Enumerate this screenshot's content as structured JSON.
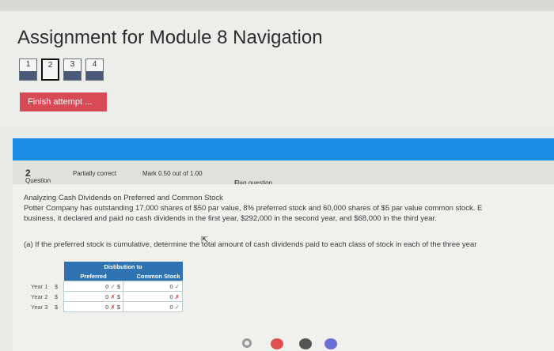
{
  "page": {
    "title": "Assignment for Module 8 Navigation"
  },
  "nav": {
    "buttons": [
      "1",
      "2",
      "3",
      "4"
    ],
    "current_index": 1
  },
  "finish_button": {
    "label": "Finish attempt ..."
  },
  "question": {
    "prefix": "Question",
    "number": "2",
    "status": "Partially correct",
    "mark": "Mark 0.50 out of 1.00",
    "flag": "Flag question"
  },
  "body": {
    "line1": "Analyzing Cash Dividends on Preferred and Common Stock",
    "line2": "Potter Company has outstanding 17,000 shares of $50 par value, 8% preferred stock and 60,000 shares of $5 par value common stock. E",
    "line3": "business, it declared and paid no cash dividends in the first year, $292,000 in the second year, and $68,000 in the third year.",
    "part_a": "(a) If the preferred stock is cumulative, determine the total amount of cash dividends paid to each class of stock in each of the three year"
  },
  "table": {
    "title": "Distibution to",
    "col_preferred": "Preferred",
    "col_common": "Common Stock",
    "currency": "$",
    "rows": [
      {
        "year": "Year 1",
        "pref_value": "0",
        "pref_mark": "✓",
        "comm_value": "0",
        "comm_mark": "✓"
      },
      {
        "year": "Year 2",
        "pref_value": "0",
        "pref_mark": "✗",
        "comm_value": "0",
        "comm_mark": "✗"
      },
      {
        "year": "Year 3",
        "pref_value": "0",
        "pref_mark": "✗",
        "comm_value": "0",
        "comm_mark": "✓"
      }
    ]
  },
  "colors": {
    "finish_button": "#d84a55",
    "banner": "#1a8ee6",
    "table_header": "#2f73b3"
  }
}
